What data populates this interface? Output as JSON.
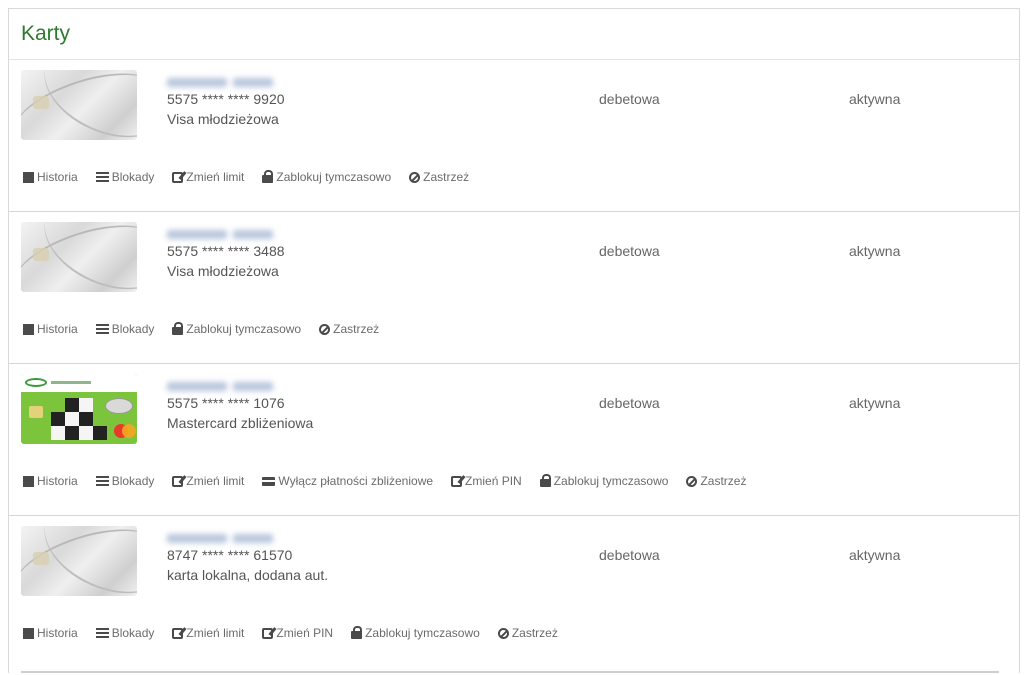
{
  "page": {
    "title": "Karty"
  },
  "cards": [
    {
      "image": "grey-card",
      "number": "5575 **** **** 9920",
      "name": "Visa młodzieżowa",
      "type": "debetowa",
      "status": "aktywna",
      "actions": [
        {
          "icon": "calendar-icon",
          "label": "Historia"
        },
        {
          "icon": "list-icon",
          "label": "Blokady"
        },
        {
          "icon": "edit-icon",
          "label": "Zmień limit"
        },
        {
          "icon": "lock-icon",
          "label": "Zablokuj tymczasowo"
        },
        {
          "icon": "ban-icon",
          "label": "Zastrzeż"
        }
      ]
    },
    {
      "image": "grey-card",
      "number": "5575 **** **** 3488",
      "name": "Visa młodzieżowa",
      "type": "debetowa",
      "status": "aktywna",
      "actions": [
        {
          "icon": "calendar-icon",
          "label": "Historia"
        },
        {
          "icon": "list-icon",
          "label": "Blokady"
        },
        {
          "icon": "lock-icon",
          "label": "Zablokuj tymczasowo"
        },
        {
          "icon": "ban-icon",
          "label": "Zastrzeż"
        }
      ]
    },
    {
      "image": "green-card",
      "number": "5575 **** **** 1076",
      "name": "Mastercard zbliżeniowa",
      "type": "debetowa",
      "status": "aktywna",
      "actions": [
        {
          "icon": "calendar-icon",
          "label": "Historia"
        },
        {
          "icon": "list-icon",
          "label": "Blokady"
        },
        {
          "icon": "edit-icon",
          "label": "Zmień limit"
        },
        {
          "icon": "credit-card-icon",
          "label": "Wyłącz płatności zbliżeniowe"
        },
        {
          "icon": "edit-icon",
          "label": "Zmień PIN"
        },
        {
          "icon": "lock-icon",
          "label": "Zablokuj tymczasowo"
        },
        {
          "icon": "ban-icon",
          "label": "Zastrzeż"
        }
      ]
    },
    {
      "image": "grey-card",
      "number": "8747 **** **** 61570",
      "name": "karta lokalna, dodana aut.",
      "type": "debetowa",
      "status": "aktywna",
      "actions": [
        {
          "icon": "calendar-icon",
          "label": "Historia"
        },
        {
          "icon": "list-icon",
          "label": "Blokady"
        },
        {
          "icon": "edit-icon",
          "label": "Zmień limit"
        },
        {
          "icon": "edit-icon",
          "label": "Zmień PIN"
        },
        {
          "icon": "lock-icon",
          "label": "Zablokuj tymczasowo"
        },
        {
          "icon": "ban-icon",
          "label": "Zastrzeż"
        }
      ]
    }
  ]
}
